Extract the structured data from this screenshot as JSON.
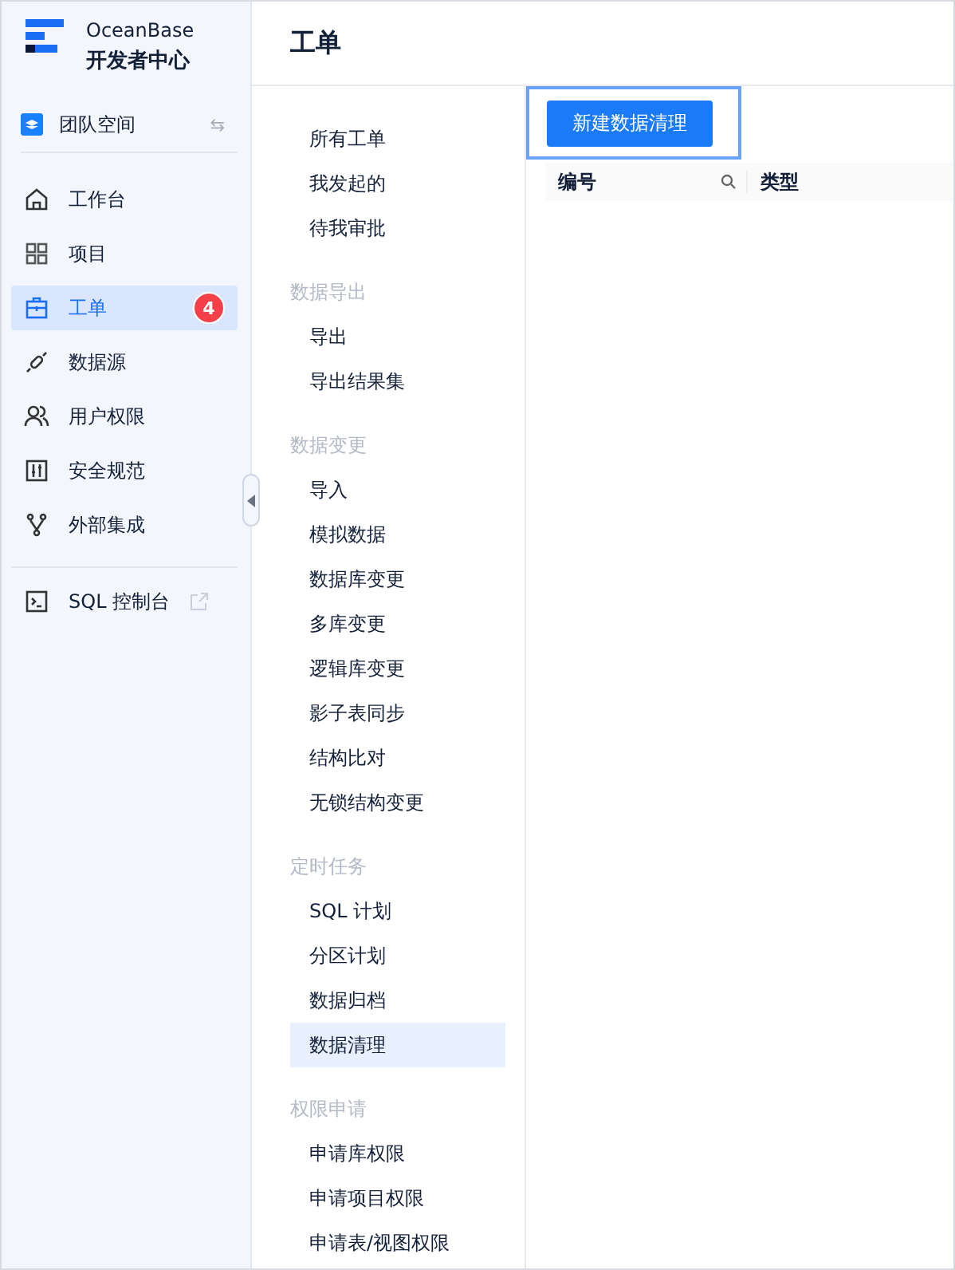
{
  "brand": {
    "name": "OceanBase",
    "subtitle": "开发者中心"
  },
  "workspace": {
    "label": "团队空间",
    "switch_icon": "⇆"
  },
  "nav": [
    {
      "label": "工作台",
      "kind": "home",
      "selected": false
    },
    {
      "label": "项目",
      "kind": "grid",
      "selected": false
    },
    {
      "label": "工单",
      "kind": "ticket",
      "selected": true,
      "badge": "4"
    },
    {
      "label": "数据源",
      "kind": "plug",
      "selected": false
    },
    {
      "label": "用户权限",
      "kind": "users",
      "selected": false
    },
    {
      "label": "安全规范",
      "kind": "sliders",
      "selected": false
    },
    {
      "label": "外部集成",
      "kind": "branch",
      "selected": false
    }
  ],
  "console": {
    "label": "SQL 控制台",
    "kind": "terminal"
  },
  "page_title": "工单",
  "submenu": [
    {
      "items": [
        {
          "label": "所有工单",
          "selected": false
        },
        {
          "label": "我发起的",
          "selected": false
        },
        {
          "label": "待我审批",
          "selected": false
        }
      ]
    },
    {
      "heading": "数据导出",
      "items": [
        {
          "label": "导出",
          "selected": false
        },
        {
          "label": "导出结果集",
          "selected": false
        }
      ]
    },
    {
      "heading": "数据变更",
      "items": [
        {
          "label": "导入",
          "selected": false
        },
        {
          "label": "模拟数据",
          "selected": false
        },
        {
          "label": "数据库变更",
          "selected": false
        },
        {
          "label": "多库变更",
          "selected": false
        },
        {
          "label": "逻辑库变更",
          "selected": false
        },
        {
          "label": "影子表同步",
          "selected": false
        },
        {
          "label": "结构比对",
          "selected": false
        },
        {
          "label": "无锁结构变更",
          "selected": false
        }
      ]
    },
    {
      "heading": "定时任务",
      "items": [
        {
          "label": "SQL 计划",
          "selected": false
        },
        {
          "label": "分区计划",
          "selected": false
        },
        {
          "label": "数据归档",
          "selected": false
        },
        {
          "label": "数据清理",
          "selected": true
        }
      ]
    },
    {
      "heading": "权限申请",
      "items": [
        {
          "label": "申请库权限",
          "selected": false
        },
        {
          "label": "申请项目权限",
          "selected": false
        },
        {
          "label": "申请表/视图权限",
          "selected": false
        }
      ]
    }
  ],
  "action_button": "新建数据清理",
  "table": {
    "columns": [
      {
        "label": "编号",
        "searchable": true
      },
      {
        "label": "类型",
        "searchable": false
      }
    ]
  }
}
